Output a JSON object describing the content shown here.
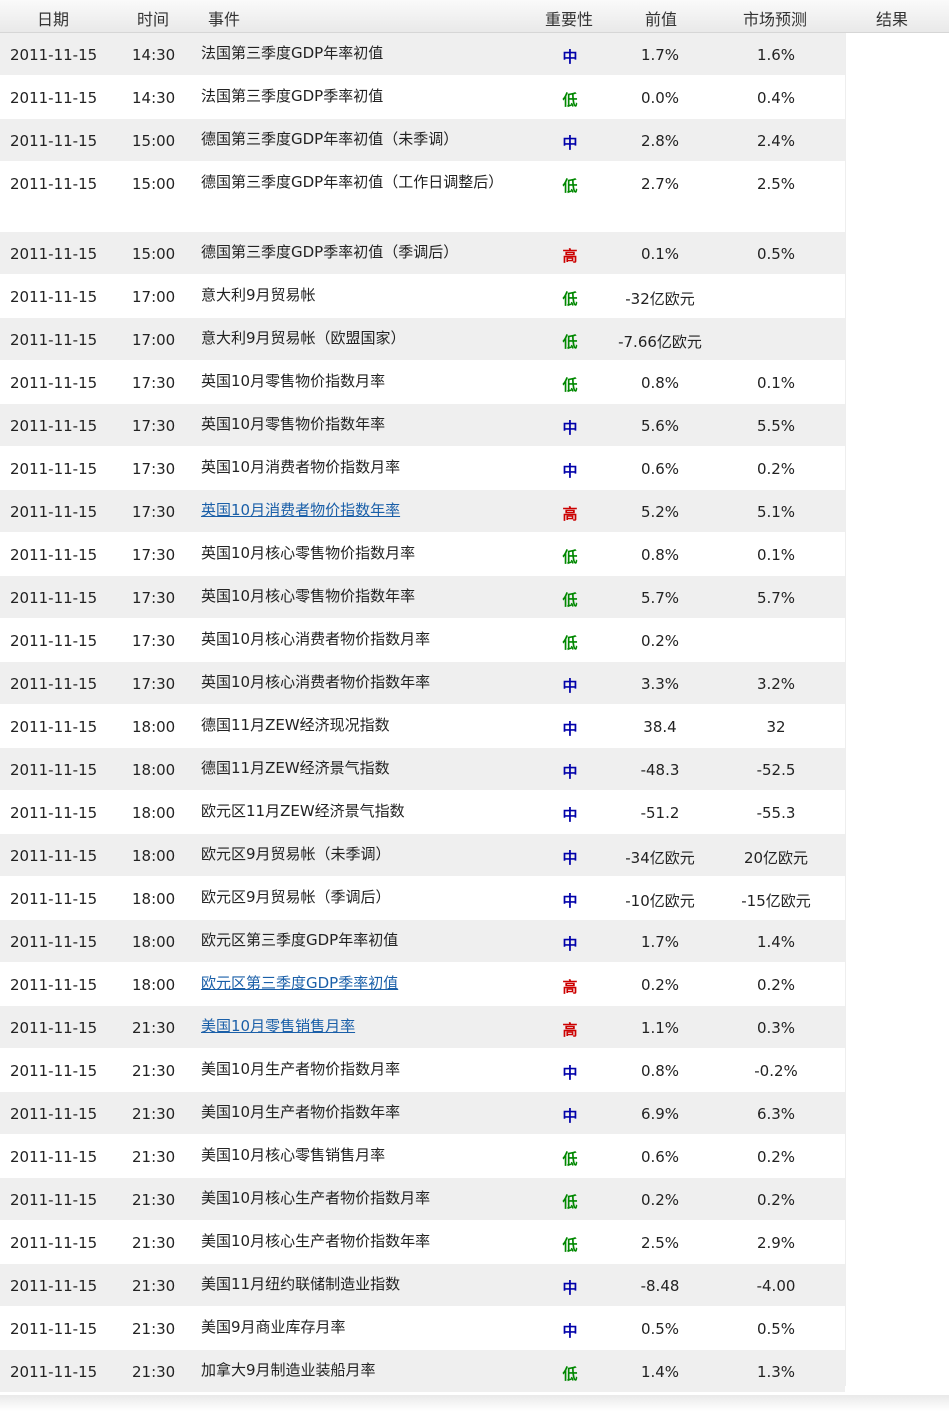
{
  "colors": {
    "high": "#cc0000",
    "medium": "#0000aa",
    "low": "#008800",
    "link": "#1a5fa8"
  },
  "header": {
    "date": "日期",
    "time": "时间",
    "event": "事件",
    "importance": "重要性",
    "previous": "前值",
    "forecast": "市场预测",
    "result": "结果"
  },
  "rows": [
    {
      "date": "2011-11-15",
      "time": "14:30",
      "event": "法国第三季度GDP年率初值",
      "importance": "中",
      "level": "medium",
      "previous": "1.7%",
      "forecast": "1.6%"
    },
    {
      "date": "2011-11-15",
      "time": "14:30",
      "event": "法国第三季度GDP季率初值",
      "importance": "低",
      "level": "low",
      "previous": "0.0%",
      "forecast": "0.4%"
    },
    {
      "date": "2011-11-15",
      "time": "15:00",
      "event": "德国第三季度GDP年率初值（未季调）",
      "importance": "中",
      "level": "medium",
      "previous": "2.8%",
      "forecast": "2.4%"
    },
    {
      "date": "2011-11-15",
      "time": "15:00",
      "event": "德国第三季度GDP年率初值（工作日调整后）",
      "importance": "低",
      "level": "low",
      "previous": "2.7%",
      "forecast": "2.5%",
      "tall": true
    },
    {
      "date": "2011-11-15",
      "time": "15:00",
      "event": "德国第三季度GDP季率初值（季调后）",
      "importance": "高",
      "level": "high",
      "previous": "0.1%",
      "forecast": "0.5%"
    },
    {
      "date": "2011-11-15",
      "time": "17:00",
      "event": "意大利9月贸易帐",
      "importance": "低",
      "level": "low",
      "previous": "-32亿欧元",
      "forecast": ""
    },
    {
      "date": "2011-11-15",
      "time": "17:00",
      "event": "意大利9月贸易帐（欧盟国家）",
      "importance": "低",
      "level": "low",
      "previous": "-7.66亿欧元",
      "forecast": ""
    },
    {
      "date": "2011-11-15",
      "time": "17:30",
      "event": "英国10月零售物价指数月率",
      "importance": "低",
      "level": "low",
      "previous": "0.8%",
      "forecast": "0.1%"
    },
    {
      "date": "2011-11-15",
      "time": "17:30",
      "event": "英国10月零售物价指数年率",
      "importance": "中",
      "level": "medium",
      "previous": "5.6%",
      "forecast": "5.5%"
    },
    {
      "date": "2011-11-15",
      "time": "17:30",
      "event": "英国10月消费者物价指数月率",
      "importance": "中",
      "level": "medium",
      "previous": "0.6%",
      "forecast": "0.2%"
    },
    {
      "date": "2011-11-15",
      "time": "17:30",
      "event": "英国10月消费者物价指数年率",
      "importance": "高",
      "level": "high",
      "previous": "5.2%",
      "forecast": "5.1%",
      "link": true
    },
    {
      "date": "2011-11-15",
      "time": "17:30",
      "event": "英国10月核心零售物价指数月率",
      "importance": "低",
      "level": "low",
      "previous": "0.8%",
      "forecast": "0.1%"
    },
    {
      "date": "2011-11-15",
      "time": "17:30",
      "event": "英国10月核心零售物价指数年率",
      "importance": "低",
      "level": "low",
      "previous": "5.7%",
      "forecast": "5.7%"
    },
    {
      "date": "2011-11-15",
      "time": "17:30",
      "event": "英国10月核心消费者物价指数月率",
      "importance": "低",
      "level": "low",
      "previous": "0.2%",
      "forecast": ""
    },
    {
      "date": "2011-11-15",
      "time": "17:30",
      "event": "英国10月核心消费者物价指数年率",
      "importance": "中",
      "level": "medium",
      "previous": "3.3%",
      "forecast": "3.2%"
    },
    {
      "date": "2011-11-15",
      "time": "18:00",
      "event": "德国11月ZEW经济现况指数",
      "importance": "中",
      "level": "medium",
      "previous": "38.4",
      "forecast": "32"
    },
    {
      "date": "2011-11-15",
      "time": "18:00",
      "event": "德国11月ZEW经济景气指数",
      "importance": "中",
      "level": "medium",
      "previous": "-48.3",
      "forecast": "-52.5"
    },
    {
      "date": "2011-11-15",
      "time": "18:00",
      "event": "欧元区11月ZEW经济景气指数",
      "importance": "中",
      "level": "medium",
      "previous": "-51.2",
      "forecast": "-55.3"
    },
    {
      "date": "2011-11-15",
      "time": "18:00",
      "event": "欧元区9月贸易帐（未季调）",
      "importance": "中",
      "level": "medium",
      "previous": "-34亿欧元",
      "forecast": "20亿欧元"
    },
    {
      "date": "2011-11-15",
      "time": "18:00",
      "event": "欧元区9月贸易帐（季调后）",
      "importance": "中",
      "level": "medium",
      "previous": "-10亿欧元",
      "forecast": "-15亿欧元"
    },
    {
      "date": "2011-11-15",
      "time": "18:00",
      "event": "欧元区第三季度GDP年率初值",
      "importance": "中",
      "level": "medium",
      "previous": "1.7%",
      "forecast": "1.4%"
    },
    {
      "date": "2011-11-15",
      "time": "18:00",
      "event": "欧元区第三季度GDP季率初值",
      "importance": "高",
      "level": "high",
      "previous": "0.2%",
      "forecast": "0.2%",
      "link": true
    },
    {
      "date": "2011-11-15",
      "time": "21:30",
      "event": "美国10月零售销售月率",
      "importance": "高",
      "level": "high",
      "previous": "1.1%",
      "forecast": "0.3%",
      "link": true
    },
    {
      "date": "2011-11-15",
      "time": "21:30",
      "event": "美国10月生产者物价指数月率",
      "importance": "中",
      "level": "medium",
      "previous": "0.8%",
      "forecast": "-0.2%"
    },
    {
      "date": "2011-11-15",
      "time": "21:30",
      "event": "美国10月生产者物价指数年率",
      "importance": "中",
      "level": "medium",
      "previous": "6.9%",
      "forecast": "6.3%"
    },
    {
      "date": "2011-11-15",
      "time": "21:30",
      "event": "美国10月核心零售销售月率",
      "importance": "低",
      "level": "low",
      "previous": "0.6%",
      "forecast": "0.2%"
    },
    {
      "date": "2011-11-15",
      "time": "21:30",
      "event": "美国10月核心生产者物价指数月率",
      "importance": "低",
      "level": "low",
      "previous": "0.2%",
      "forecast": "0.2%"
    },
    {
      "date": "2011-11-15",
      "time": "21:30",
      "event": "美国10月核心生产者物价指数年率",
      "importance": "低",
      "level": "low",
      "previous": "2.5%",
      "forecast": "2.9%"
    },
    {
      "date": "2011-11-15",
      "time": "21:30",
      "event": "美国11月纽约联储制造业指数",
      "importance": "中",
      "level": "medium",
      "previous": "-8.48",
      "forecast": "-4.00"
    },
    {
      "date": "2011-11-15",
      "time": "21:30",
      "event": "美国9月商业库存月率",
      "importance": "中",
      "level": "medium",
      "previous": "0.5%",
      "forecast": "0.5%"
    },
    {
      "date": "2011-11-15",
      "time": "21:30",
      "event": "加拿大9月制造业装船月率",
      "importance": "低",
      "level": "low",
      "previous": "1.4%",
      "forecast": "1.3%"
    }
  ]
}
